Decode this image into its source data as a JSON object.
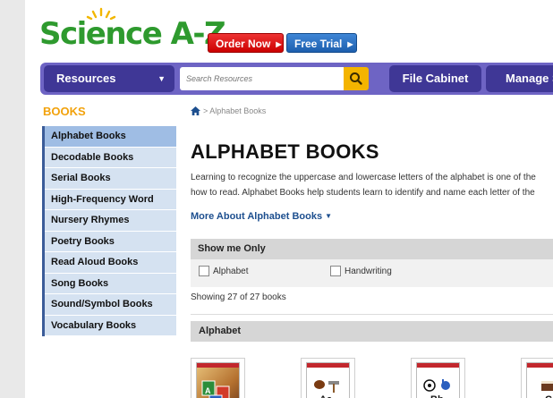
{
  "header": {
    "logo_text": "Science A-Z",
    "order_now": "Order Now",
    "free_trial": "Free Trial"
  },
  "nav": {
    "resources": "Resources",
    "search_placeholder": "Search Resources",
    "file_cabinet": "File Cabinet",
    "manage": "Manage S"
  },
  "sidebar": {
    "heading": "BOOKS",
    "items": [
      {
        "label": "Alphabet Books",
        "active": true
      },
      {
        "label": "Decodable Books"
      },
      {
        "label": "Serial  Books"
      },
      {
        "label": "High-Frequency Word"
      },
      {
        "label": "Nursery Rhymes"
      },
      {
        "label": "Poetry Books"
      },
      {
        "label": "Read Aloud Books"
      },
      {
        "label": "Song Books"
      },
      {
        "label": "Sound/Symbol Books"
      },
      {
        "label": "Vocabulary Books"
      }
    ]
  },
  "main": {
    "breadcrumb": "Alphabet Books",
    "title": "ALPHABET BOOKS",
    "intro_line1": "Learning to recognize the uppercase and lowercase letters of the alphabet is one of the",
    "intro_line2": "how to read. Alphabet Books help students learn to identify and name each letter of the",
    "more_about": "More About Alphabet Books",
    "filter": {
      "header": "Show me Only",
      "options": [
        "Alphabet",
        "Handwriting"
      ]
    },
    "count_text": "Showing 27 of 27 books",
    "section_title": "Alphabet",
    "books": [
      {
        "letters": "A"
      },
      {
        "letters": "Aa"
      },
      {
        "letters": "Bb"
      },
      {
        "letters": "C"
      }
    ]
  },
  "colors": {
    "logo_green": "#2e9a2e",
    "nav_purple": "#6e64c4",
    "nav_button": "#3f3796",
    "search_button": "#f4b400",
    "order_red": "#cc0000",
    "trial_blue": "#1d5fae",
    "books_heading": "#f2a20c",
    "sidebar_active": "#9fbde4",
    "sidebar_item": "#d5e2f1",
    "link_blue": "#1d4f8f"
  },
  "icons": {
    "search": "magnifier-icon",
    "home": "home-icon",
    "dropdown": "caret-down-icon",
    "arrow": "arrow-right-icon"
  }
}
